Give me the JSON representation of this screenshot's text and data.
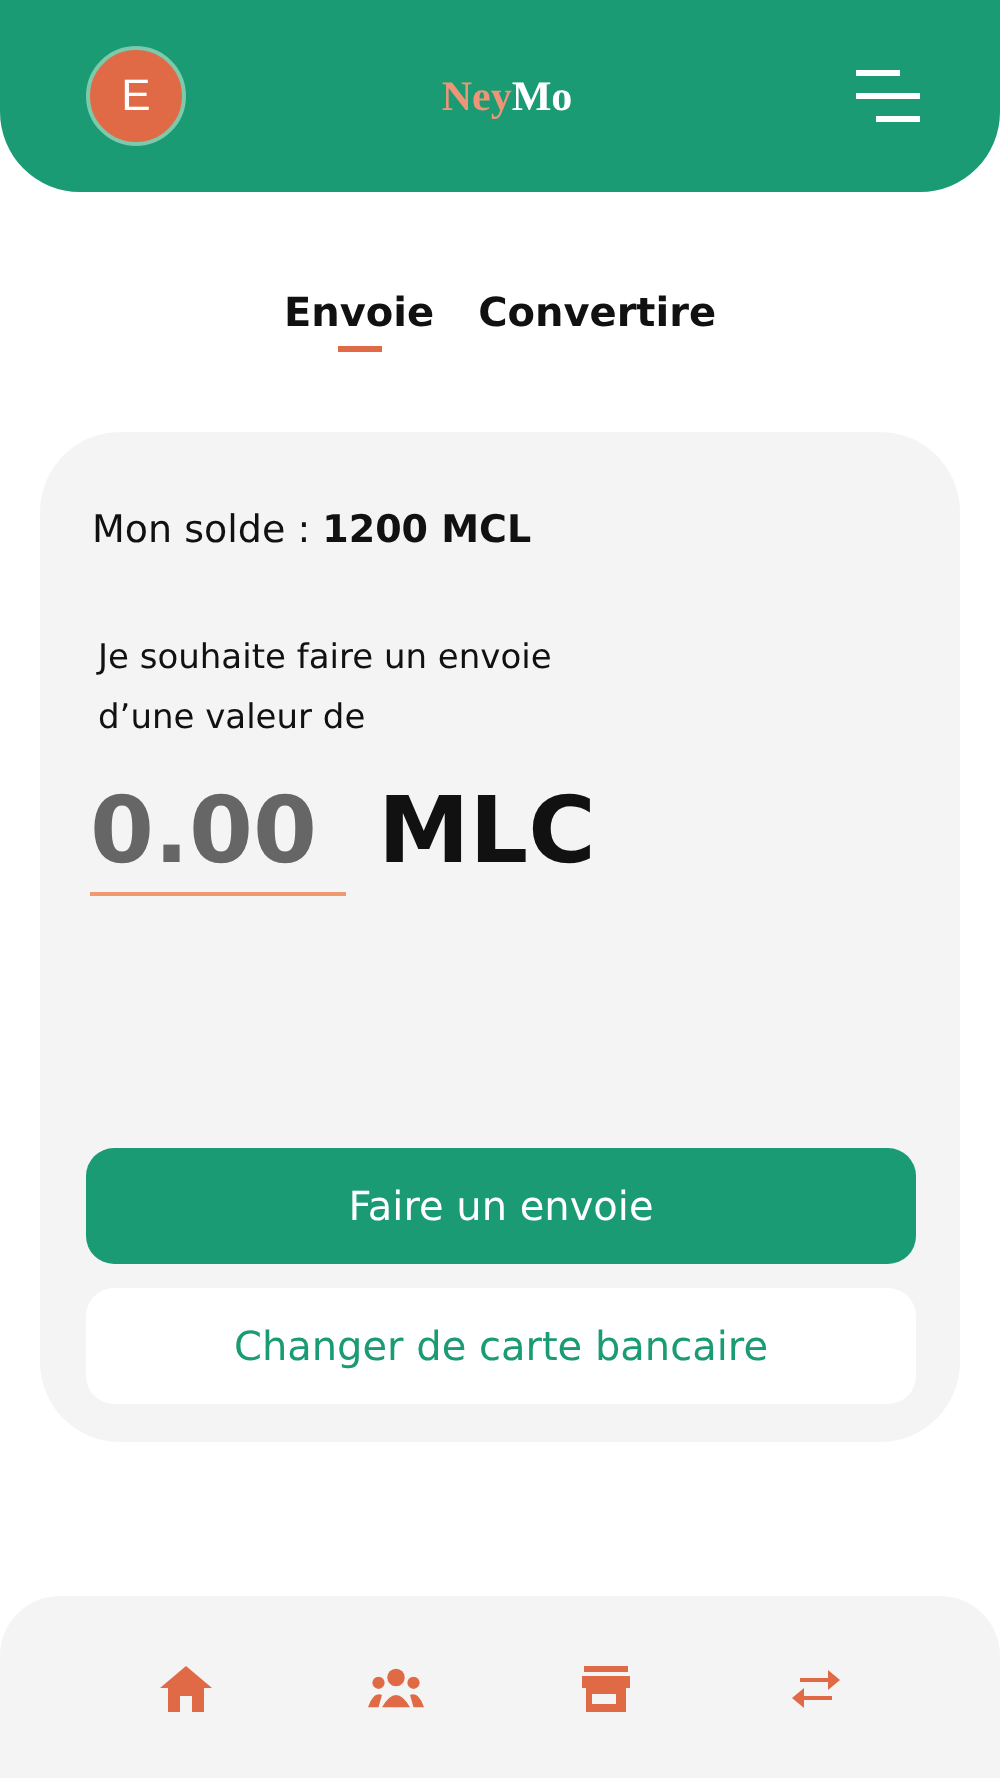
{
  "header": {
    "avatar": "E",
    "logo": {
      "first": "Ney",
      "second": "Mo"
    }
  },
  "tabs": [
    {
      "label": "Envoie",
      "selected": true
    },
    {
      "label": "Convertire",
      "selected": false
    }
  ],
  "card": {
    "balance": "Mon solde : **1200 MCL**",
    "prompt": "Je souhaite faire un envoie\nd’une valeur de",
    "amount": {
      "placeholder": "0.00",
      "currency": "MLC"
    },
    "buttons": [
      {
        "label": "Faire un envoie",
        "kind": "primary"
      },
      {
        "label": "Changer de carte bancaire",
        "kind": "secondary"
      }
    ]
  }
}
